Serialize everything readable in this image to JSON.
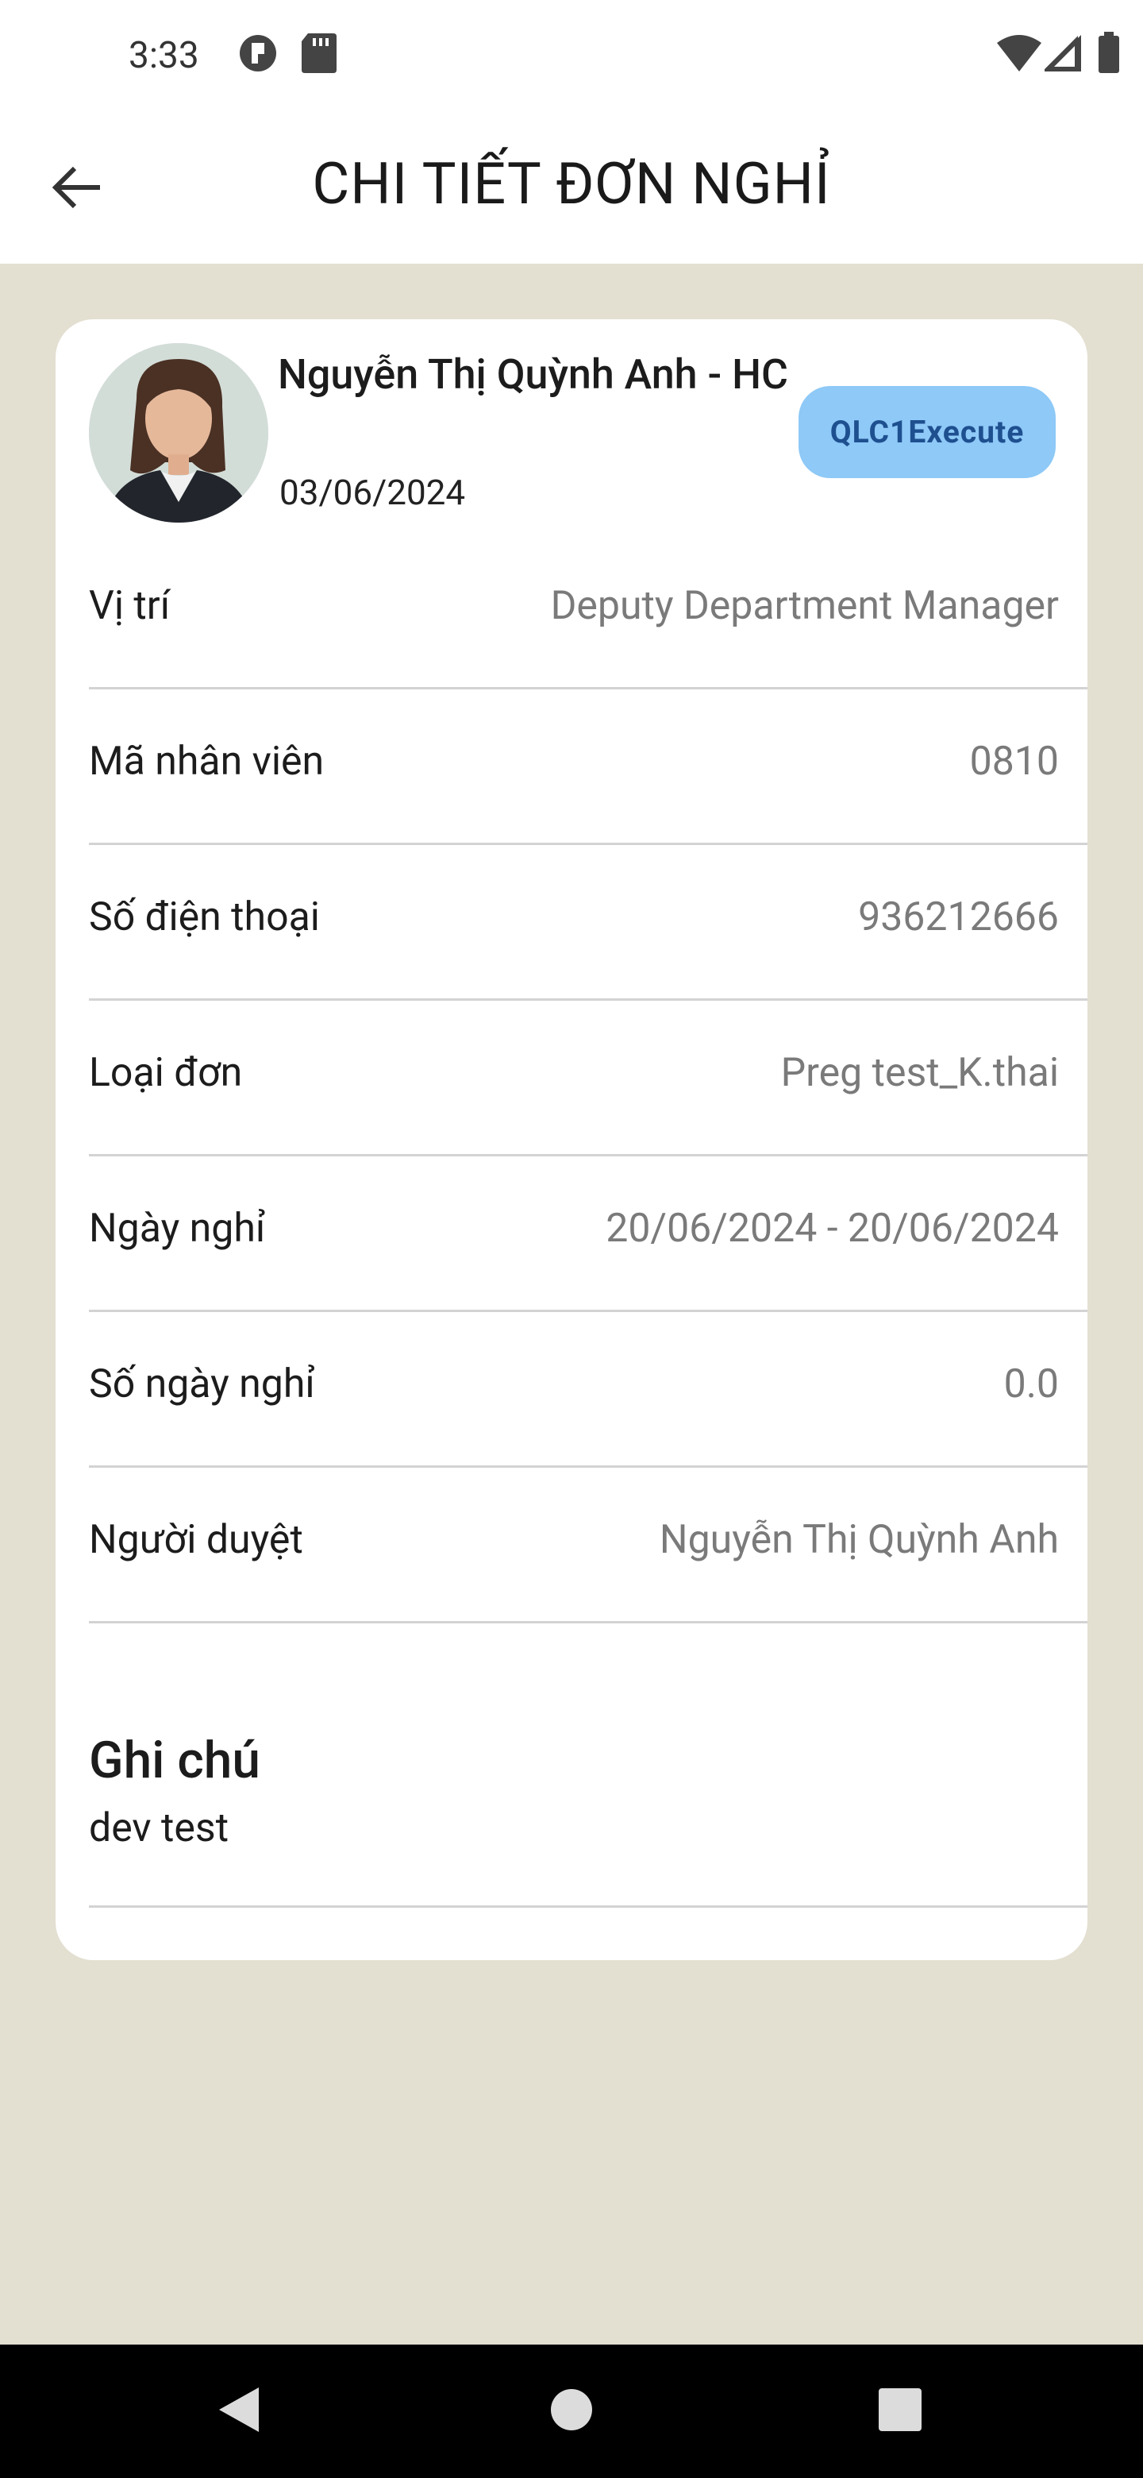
{
  "status_bar": {
    "time": "3:33",
    "icons": [
      "app-notification-icon",
      "sd-card-icon",
      "wifi-icon",
      "cell-signal-icon",
      "battery-icon"
    ]
  },
  "app_bar": {
    "title": "CHI TIẾT ĐƠN NGHỈ",
    "back_icon": "arrow-back-icon"
  },
  "employee": {
    "name": "Nguyễn Thị Quỳnh Anh - HC",
    "date": "03/06/2024",
    "badge": "QLC1Execute"
  },
  "details": [
    {
      "label": "Vị trí",
      "value": "Deputy Department Manager"
    },
    {
      "label": "Mã nhân viên",
      "value": "0810"
    },
    {
      "label": "Số điện thoại",
      "value": "936212666"
    },
    {
      "label": "Loại đơn",
      "value": "Preg test_K.thai"
    },
    {
      "label": "Ngày nghỉ",
      "value": "20/06/2024 - 20/06/2024"
    },
    {
      "label": "Số ngày nghỉ",
      "value": "0.0"
    },
    {
      "label": "Người duyệt",
      "value": "Nguyễn Thị Quỳnh Anh"
    }
  ],
  "note": {
    "title": "Ghi chú",
    "text": "dev test"
  },
  "nav": {
    "icons": [
      "nav-back-icon",
      "nav-home-icon",
      "nav-recents-icon"
    ]
  },
  "colors": {
    "background": "#e3dfd1",
    "badge_bg": "#8ec9f7",
    "badge_text": "#1e4f8f"
  }
}
